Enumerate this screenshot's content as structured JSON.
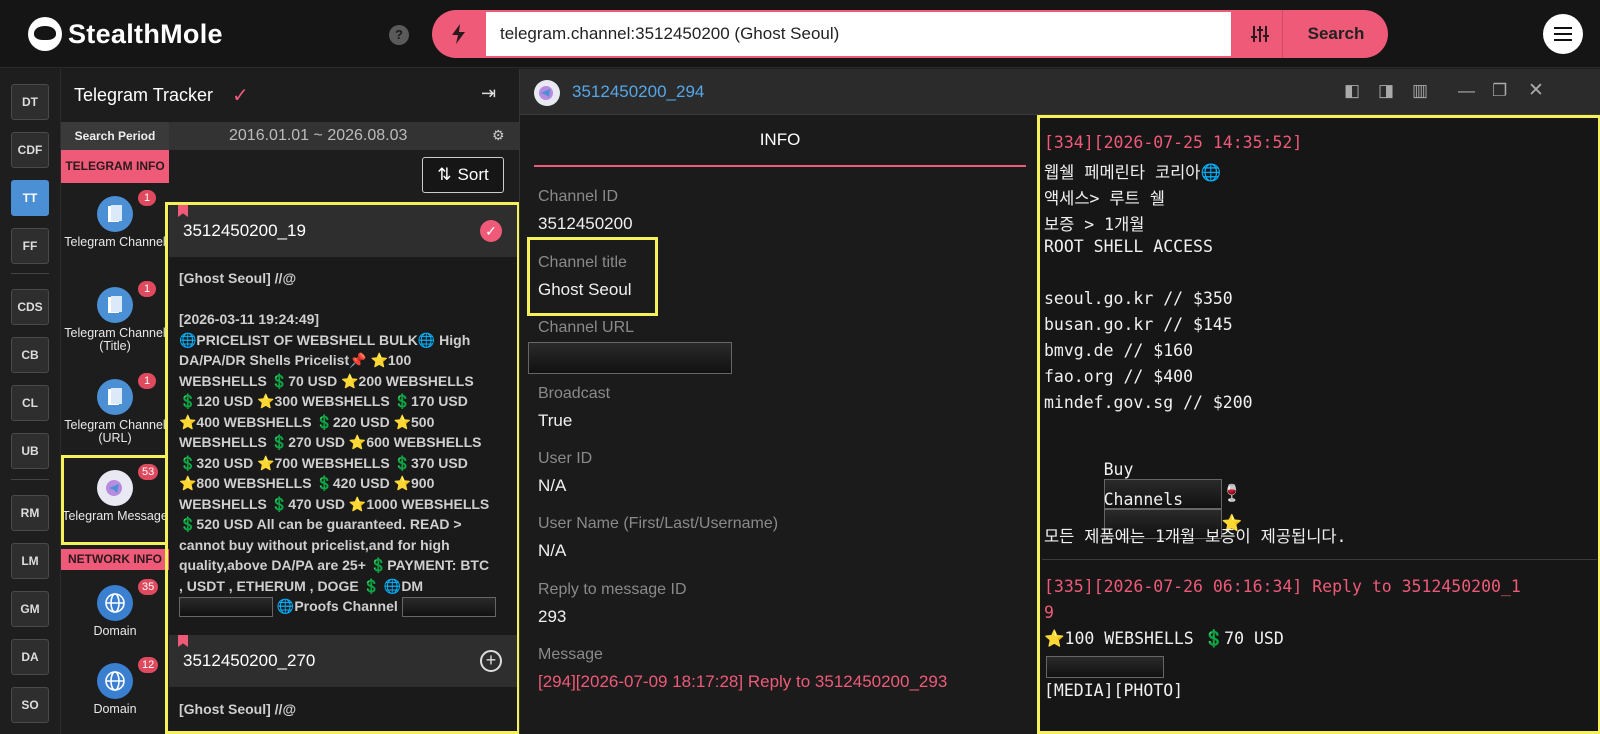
{
  "header": {
    "brand": "StealthMole",
    "help_label": "?",
    "search_value": "telegram.channel:3512450200 (Ghost Seoul)",
    "search_button": "Search",
    "icons": [
      "bolt-icon",
      "filter-sliders-icon",
      "menu-icon",
      "help-icon"
    ]
  },
  "rail": {
    "items": [
      "DT",
      "CDF",
      "TT",
      "FF",
      "CDS",
      "CB",
      "CL",
      "UB",
      "RM",
      "LM",
      "GM",
      "DA",
      "SO"
    ],
    "active": "TT"
  },
  "tracker": {
    "title": "Telegram Tracker",
    "period_label": "Search Period",
    "period_value": "2016.01.01 ~ 2026.08.03",
    "sort_label": "Sort",
    "telegram_info_label": "TELEGRAM INFO",
    "network_info_label": "NETWORK INFO",
    "categories": [
      {
        "label": "Telegram Channel",
        "badge": "1"
      },
      {
        "label": "Telegram Channel (Title)",
        "badge": "1"
      },
      {
        "label": "Telegram Channel (URL)",
        "badge": "1"
      },
      {
        "label": "Telegram Message",
        "badge": "53"
      },
      {
        "label": "Domain",
        "badge": "35"
      },
      {
        "label": "Domain",
        "badge": "12"
      }
    ],
    "cards": [
      {
        "id": "3512450200_19",
        "lines": [
          "[Ghost Seoul] //@",
          "",
          "[2026-03-11 19:24:49]",
          "🌐PRICELIST OF WEBSHELL BULK🌐 High",
          "DA/PA/DR Shells Pricelist📌 ⭐100",
          "WEBSHELLS 💲70 USD ⭐200 WEBSHELLS",
          "💲120 USD ⭐300 WEBSHELLS 💲170 USD",
          "⭐400 WEBSHELLS 💲220 USD ⭐500",
          "WEBSHELLS 💲270 USD ⭐600 WEBSHELLS",
          "💲320 USD ⭐700 WEBSHELLS 💲370 USD",
          "⭐800 WEBSHELLS 💲420 USD ⭐900",
          "WEBSHELLS 💲470 USD ⭐1000 WEBSHELLS",
          "💲520 USD All can be guaranteed. READ >",
          "cannot buy without pricelist,and for high",
          "quality,above DA/PA are 25+ 💲PAYMENT: BTC",
          ", USDT , ETHERUM , DOGE 💲 🌐DM"
        ],
        "proofs_text": "🌐Proofs Channel"
      },
      {
        "id": "3512450200_270",
        "lines": [
          "[Ghost Seoul] //@"
        ]
      }
    ]
  },
  "detail": {
    "title": "3512450200_294",
    "tab": "INFO",
    "fields": [
      {
        "label": "Channel ID",
        "value": "3512450200"
      },
      {
        "label": "Channel title",
        "value": "Ghost Seoul"
      },
      {
        "label": "Channel URL",
        "value": ""
      },
      {
        "label": "Broadcast",
        "value": "True"
      },
      {
        "label": "User ID",
        "value": "N/A"
      },
      {
        "label": "User Name (First/Last/Username)",
        "value": "N/A"
      },
      {
        "label": "Reply to message ID",
        "value": "293"
      },
      {
        "label": "Message",
        "value": "[294][2026-07-09 18:17:28] Reply to 3512450200_293"
      }
    ]
  },
  "messages": {
    "block1": {
      "header": "[334][2026-07-25 14:35:52]",
      "lines": [
        "웹쉘 페메린타 코리아🌐",
        "액세스> 루트 쉘",
        "보증 > 1개월",
        "ROOT SHELL ACCESS",
        "",
        "seoul.go.kr // $350",
        "busan.go.kr // $145",
        "bmvg.de // $160",
        "fao.org // $400",
        "mindef.gov.sg // $200"
      ],
      "buy_label": "Buy",
      "buy_suffix": "🍷",
      "channels_label": "Channels",
      "channels_suffix": "⭐",
      "footer": "모든 제품에는 1개월 보증이 제공됩니다."
    },
    "block2": {
      "header_line1": "[335][2026-07-26 06:16:34] Reply to 3512450200_1",
      "header_line2": "9",
      "line1": "⭐100 WEBSHELLS 💲70 USD",
      "line3": "[MEDIA][PHOTO]"
    }
  },
  "colors": {
    "accent": "#ef5a78",
    "link": "#56a7e8",
    "highlight": "#f4f15a",
    "rail_active": "#4b8fd4"
  }
}
